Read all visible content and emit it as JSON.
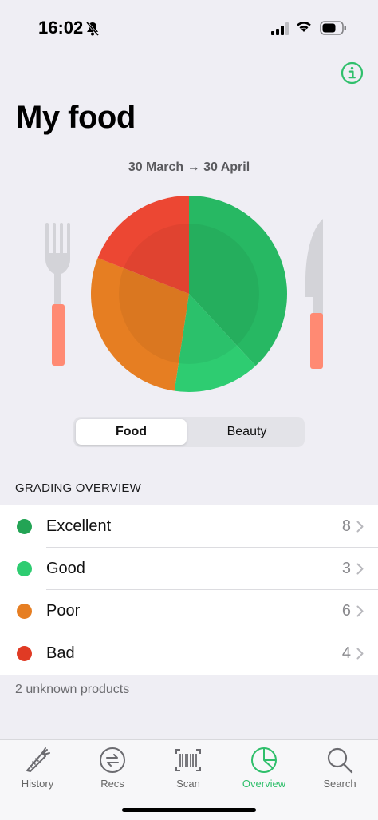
{
  "status_bar": {
    "time": "16:02"
  },
  "header": {
    "title": "My food",
    "date_range": "30 March → 30 April"
  },
  "chart_data": {
    "type": "pie",
    "title": "",
    "categories": [
      "Excellent",
      "Good",
      "Poor",
      "Bad"
    ],
    "values": [
      8,
      3,
      6,
      4
    ],
    "colors": [
      "#27B863",
      "#2ECC71",
      "#E67E22",
      "#EC4733"
    ]
  },
  "segmented": {
    "food_label": "Food",
    "beauty_label": "Beauty",
    "selected": "Food"
  },
  "grading": {
    "header": "GRADING OVERVIEW",
    "items": [
      {
        "label": "Excellent",
        "count": "8",
        "color": "#23A455"
      },
      {
        "label": "Good",
        "count": "3",
        "color": "#2ECC71"
      },
      {
        "label": "Poor",
        "count": "6",
        "color": "#E67E22"
      },
      {
        "label": "Bad",
        "count": "4",
        "color": "#E03A24"
      }
    ],
    "footnote": "2 unknown products"
  },
  "tabbar": {
    "tabs": [
      {
        "label": "History",
        "icon": "carrot-icon"
      },
      {
        "label": "Recs",
        "icon": "swap-arrows-icon"
      },
      {
        "label": "Scan",
        "icon": "barcode-icon"
      },
      {
        "label": "Overview",
        "icon": "pie-chart-icon",
        "active": true
      },
      {
        "label": "Search",
        "icon": "magnifier-icon"
      }
    ]
  },
  "accent_color": "#2FBF6B"
}
